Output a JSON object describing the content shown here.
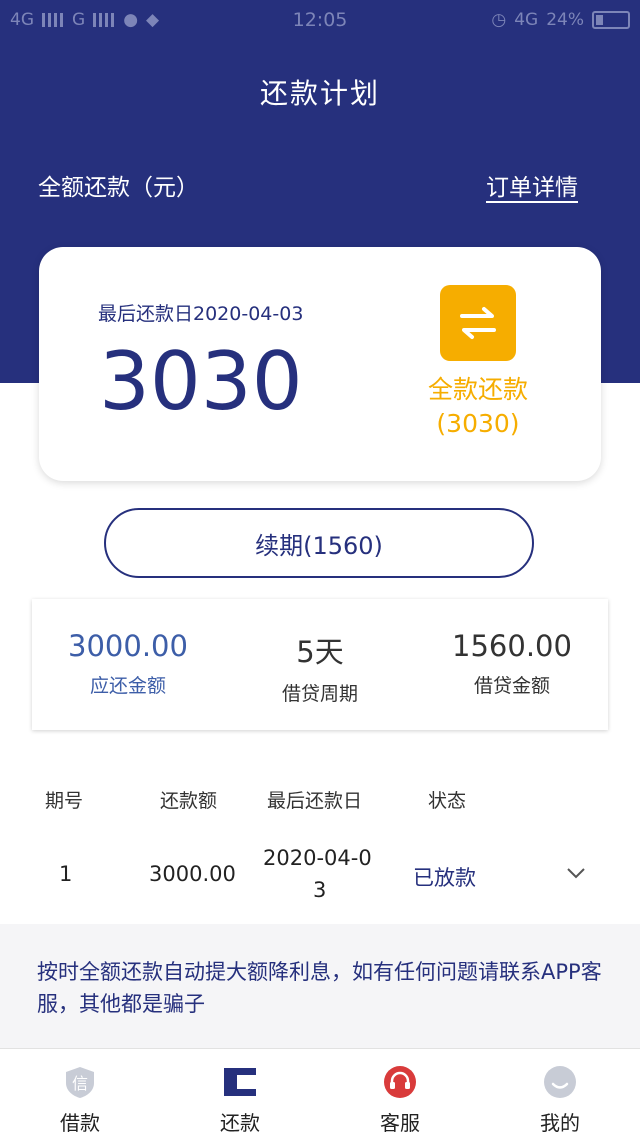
{
  "status_bar": {
    "left": [
      "4G",
      "G"
    ],
    "time": "12:05",
    "network": "4G",
    "battery": "24%"
  },
  "header": {
    "title": "还款计划",
    "left_label": "全额还款（元）",
    "right_link": "订单详情"
  },
  "card": {
    "due_label": "最后还款日2020-04-03",
    "amount": "3030",
    "full_repay_label": "全款还款",
    "full_repay_amount": "(3030)"
  },
  "renew_button": "续期(1560)",
  "stats": [
    {
      "value": "3000.00",
      "label": "应还金额"
    },
    {
      "value": "5天",
      "label": "借贷周期"
    },
    {
      "value": "1560.00",
      "label": "借贷金额"
    }
  ],
  "table": {
    "headers": [
      "期号",
      "还款额",
      "最后还款日",
      "状态"
    ],
    "rows": [
      {
        "period": "1",
        "amount": "3000.00",
        "date_line1": "2020-04-0",
        "date_line2": "3",
        "status": "已放款"
      }
    ]
  },
  "notice": "按时全额还款自动提大额降利息，如有任何问题请联系APP客服，其他都是骗子",
  "tabs": [
    {
      "label": "借款",
      "icon": "loan-shield-icon",
      "icon_text": "信"
    },
    {
      "label": "还款",
      "icon": "repay-icon"
    },
    {
      "label": "客服",
      "icon": "headset-icon"
    },
    {
      "label": "我的",
      "icon": "profile-face-icon"
    }
  ],
  "colors": {
    "primary": "#26307d",
    "accent": "#f6ad00",
    "stat_blue": "#3d5ea8",
    "support_red": "#d93b3b"
  }
}
